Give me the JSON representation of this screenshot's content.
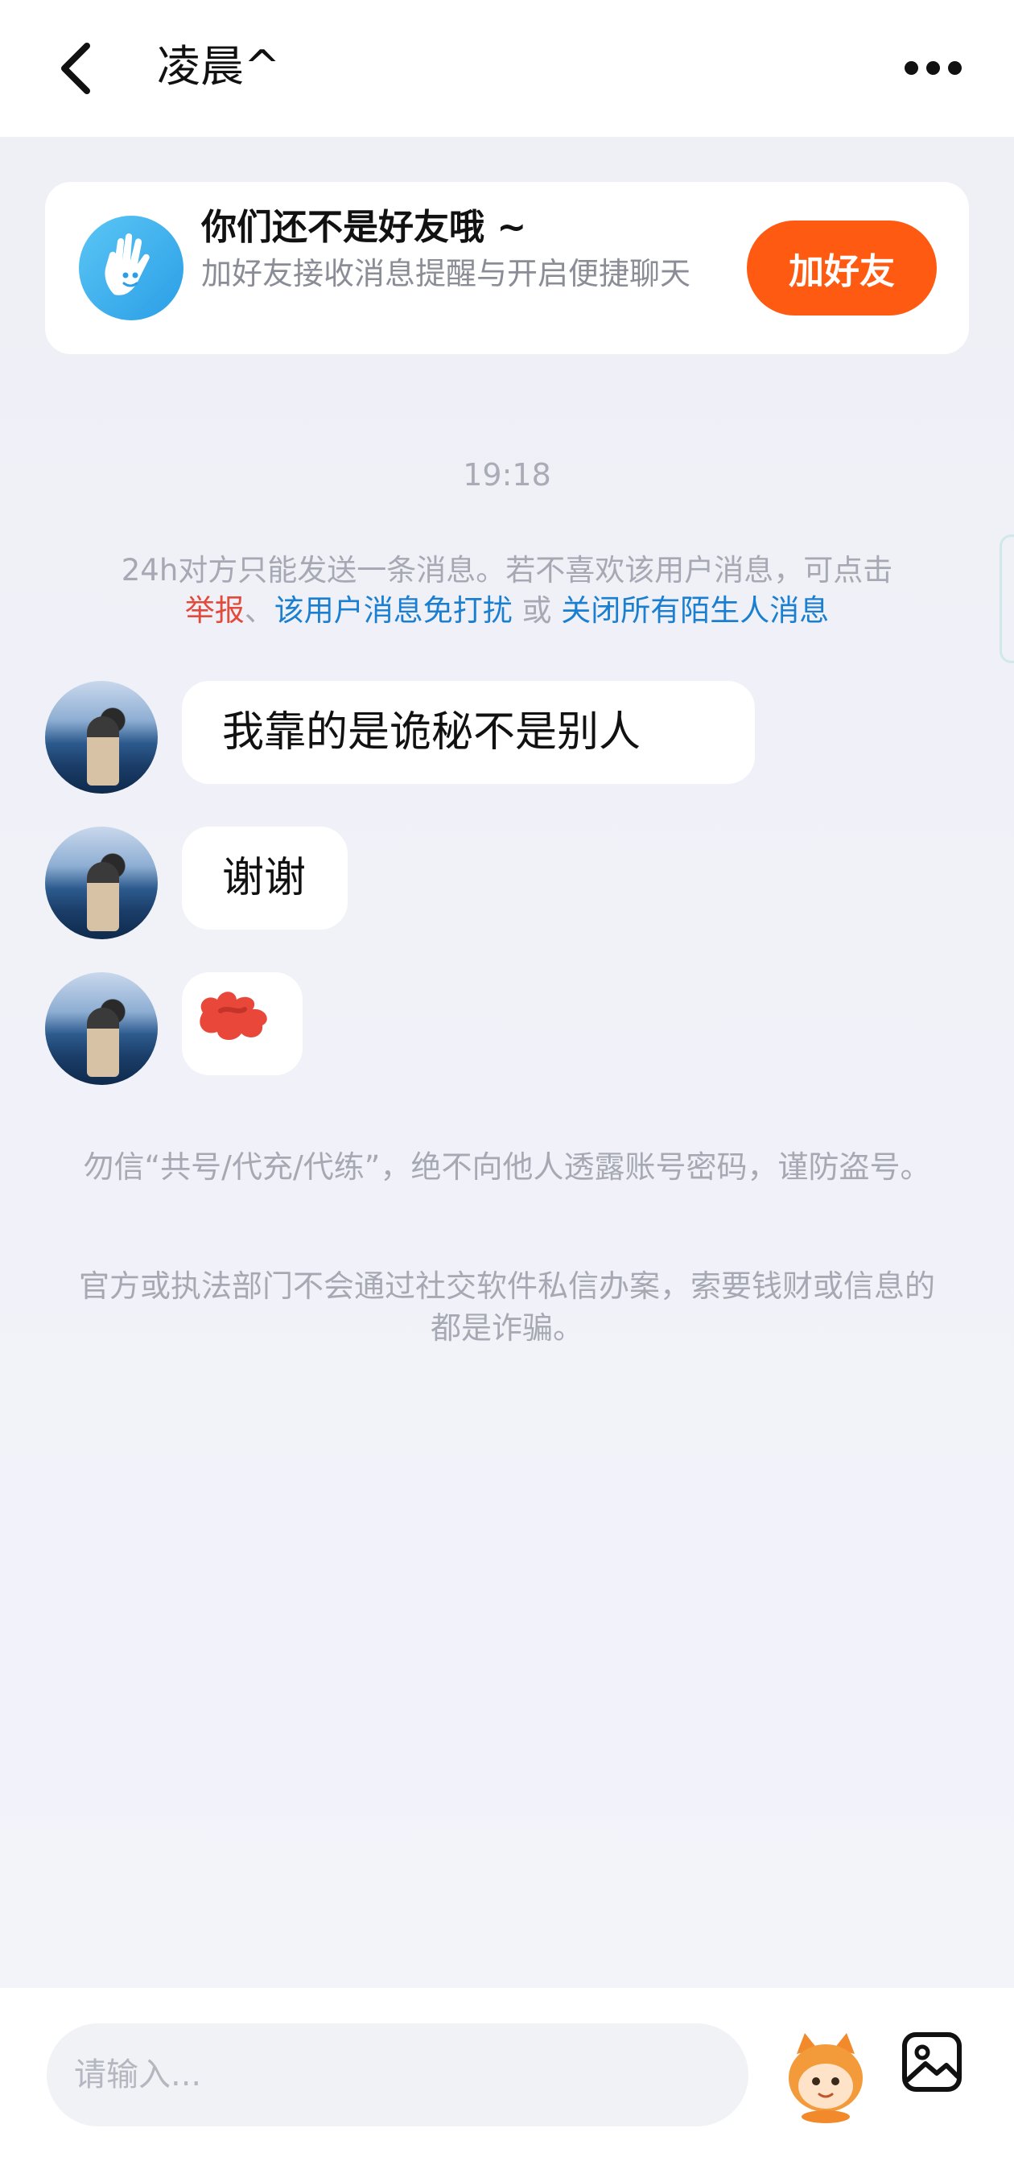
{
  "header": {
    "title": "凌晨^"
  },
  "banner": {
    "title": "你们还不是好友哦 ~",
    "subtitle": "加好友接收消息提醒与开启便捷聊天",
    "add_button": "加好友"
  },
  "chat": {
    "time": "19:18",
    "notice": {
      "text": "24h对方只能发送一条消息。若不喜欢该用户消息，可点击",
      "report": "举报",
      "sep1": "、",
      "mute": "该用户消息免打扰",
      "or": " 或 ",
      "close_all": "关闭所有陌生人消息"
    },
    "messages": [
      {
        "text": "我靠的是诡秘不是别人"
      },
      {
        "text": "谢谢"
      },
      {
        "text": "",
        "type": "sticker"
      }
    ],
    "safety": [
      "勿信“共号/代充/代练”，绝不向他人透露账号密码，谨防盗号。",
      "官方或执法部门不会通过社交软件私信办案，索要钱财或信息的都是诈骗。"
    ]
  },
  "composer": {
    "placeholder": "请输入..."
  },
  "colors": {
    "accent": "#ff5a11",
    "link_red": "#e24a3b",
    "link_blue": "#1a7fd1"
  },
  "icons": [
    "back-arrow-icon",
    "more-dots-icon",
    "hand-wave-icon",
    "emoji-mascot-icon",
    "image-icon"
  ]
}
